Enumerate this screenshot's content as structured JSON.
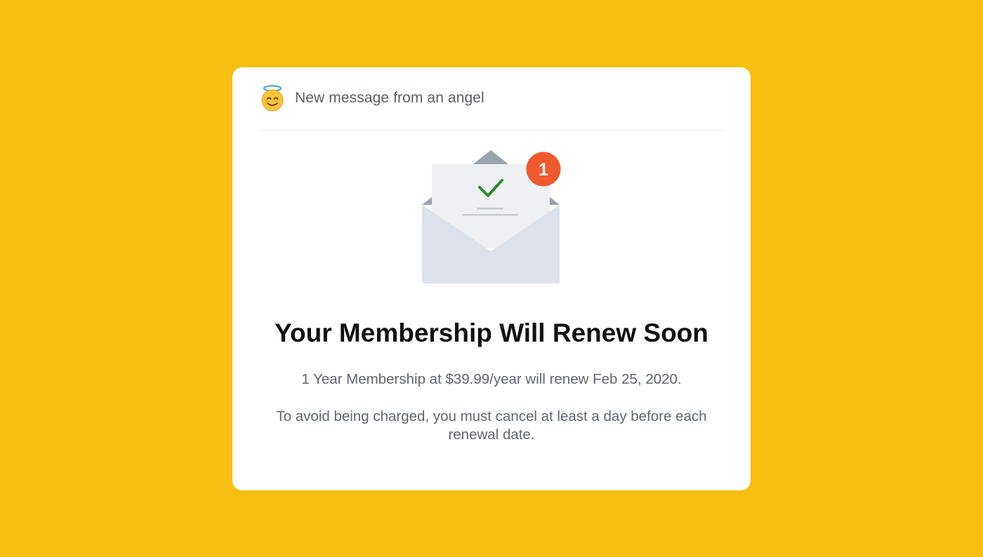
{
  "header": {
    "icon": "smiling-face-with-halo-icon",
    "text": "New message from an angel"
  },
  "illustration": {
    "icon": "open-envelope-with-checkmark-icon",
    "badge_count": "1",
    "colors": {
      "badge": "#EE5A2E",
      "check": "#2E8B2E",
      "envelope": "#DDE2EA",
      "flap": "#9AA3AE",
      "letter": "#EEF0F3"
    }
  },
  "message": {
    "title": "Your Membership Will Renew Soon",
    "renewal_info": "1 Year Membership at $39.99/year will renew Feb 25, 2020.",
    "cancel_notice": "To avoid being charged, you must cancel at least a day before each renewal date."
  },
  "colors": {
    "background": "#F7BF12",
    "card": "#FFFFFF"
  }
}
